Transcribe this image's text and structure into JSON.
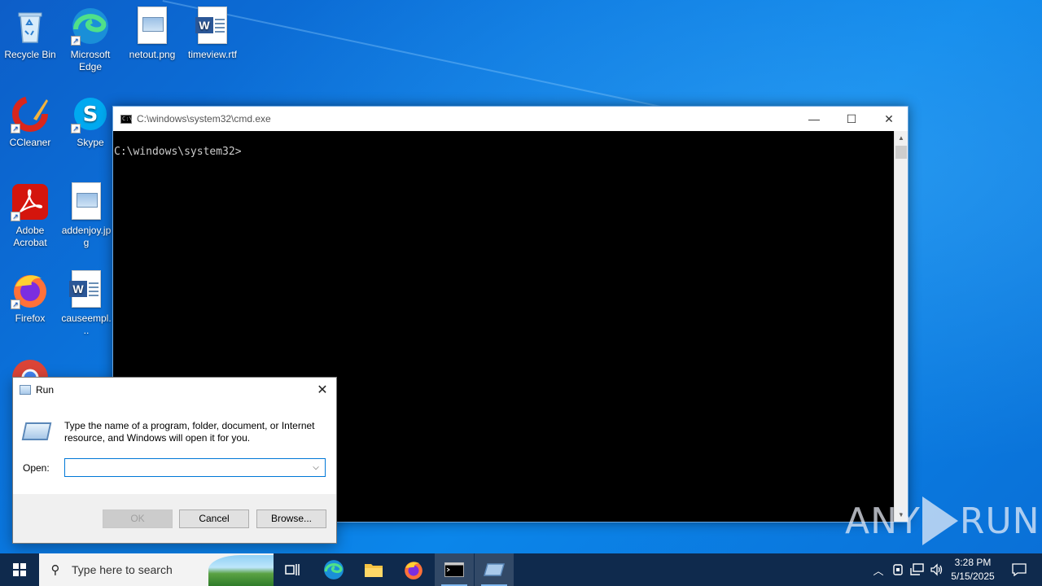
{
  "desktop": {
    "icons": [
      {
        "label": "Recycle Bin"
      },
      {
        "label": "Microsoft Edge"
      },
      {
        "label": "netout.png"
      },
      {
        "label": "timeview.rtf"
      },
      {
        "label": "CCleaner"
      },
      {
        "label": "Skype"
      },
      {
        "label": "Adobe Acrobat"
      },
      {
        "label": "addenjoy.jpg"
      },
      {
        "label": "Firefox"
      },
      {
        "label": "causeempl..."
      }
    ]
  },
  "cmd_window": {
    "title": "C:\\windows\\system32\\cmd.exe",
    "prompt": "C:\\windows\\system32>",
    "minimize": "—",
    "maximize": "☐",
    "close": "✕"
  },
  "run_dialog": {
    "title": "Run",
    "description": "Type the name of a program, folder, document, or Internet resource, and Windows will open it for you.",
    "open_label": "Open:",
    "open_value": "",
    "ok_label": "OK",
    "cancel_label": "Cancel",
    "browse_label": "Browse...",
    "close": "✕"
  },
  "taskbar": {
    "search_placeholder": "Type here to search",
    "time": "3:28 PM",
    "date": "5/15/2025",
    "apps": [
      "task-view",
      "edge",
      "file-explorer",
      "firefox",
      "cmd",
      "run"
    ]
  },
  "watermark": {
    "left": "ANY",
    "right": "RUN"
  }
}
